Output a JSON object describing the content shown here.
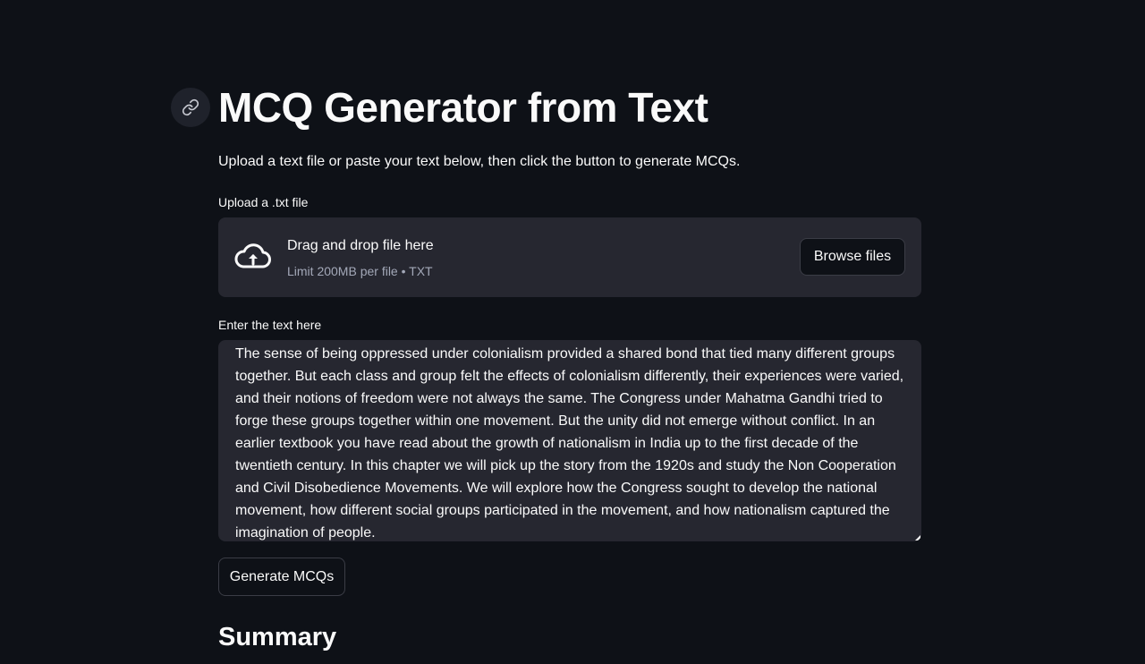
{
  "header": {
    "title": "MCQ Generator from Text",
    "anchor_icon": "link-icon"
  },
  "intro": {
    "text": "Upload a text file or paste your text below, then click the button to generate MCQs."
  },
  "uploader": {
    "label": "Upload a .txt file",
    "drag_text": "Drag and drop file here",
    "limit_text": "Limit 200MB per file • TXT",
    "browse_label": "Browse files",
    "icon": "cloud-upload-icon"
  },
  "text_input": {
    "label": "Enter the text here",
    "value": "The sense of being oppressed under colonialism provided a shared bond that tied many different groups together. But each class and group felt the effects of colonialism differently, their experiences were varied, and their notions of freedom were not always the same. The Congress under Mahatma Gandhi tried to forge these groups together within one movement. But the unity did not emerge without conflict. In an earlier textbook you have read about the growth of nationalism in India up to the first decade of the twentieth century. In this chapter we will pick up the story from the 1920s and study the Non Cooperation and Civil Disobedience Movements. We will explore how the Congress sought to develop the national movement, how different social groups participated in the movement, and how nationalism captured the imagination of people."
  },
  "actions": {
    "generate_label": "Generate MCQs"
  },
  "summary": {
    "heading": "Summary"
  },
  "colors": {
    "background": "#0e1117",
    "surface": "#262730",
    "text": "#fafafa",
    "muted_text": "#a3a8b8",
    "border": "#3b3d46"
  }
}
